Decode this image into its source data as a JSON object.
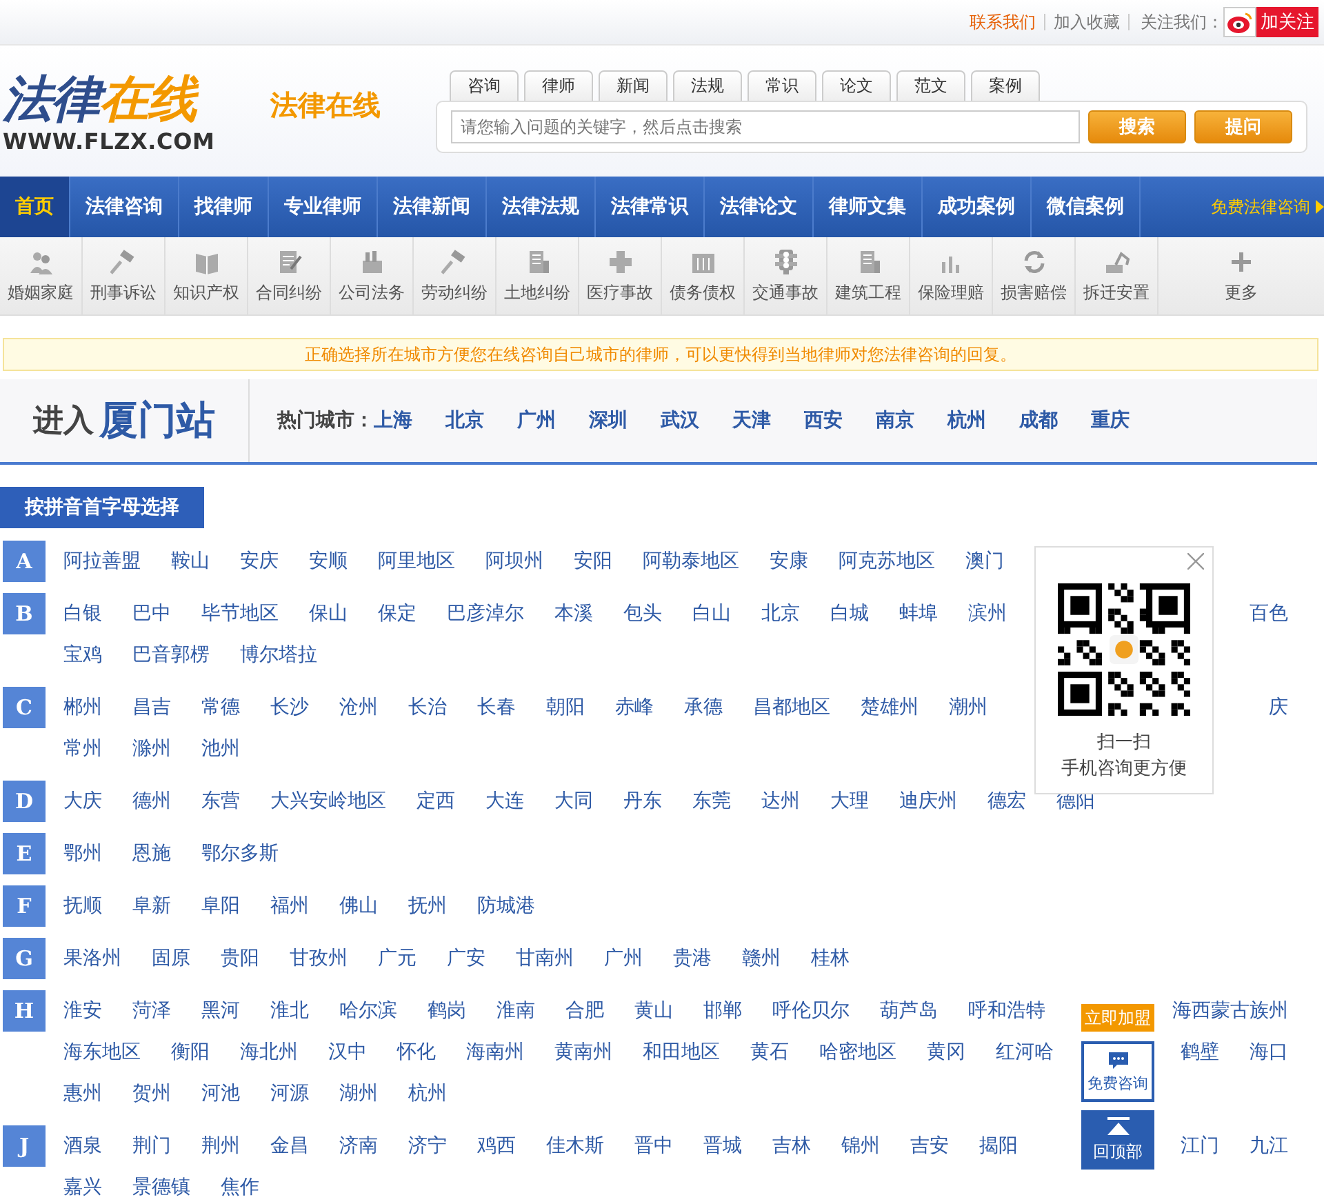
{
  "top_bar": {
    "links": [
      {
        "label": "联系我们",
        "kind": "highlight"
      },
      {
        "label": "加入收藏",
        "kind": "plain"
      }
    ],
    "follow_label": "关注我们：",
    "follow_button": "加关注"
  },
  "logo": {
    "main": "法律",
    "accent": "在线",
    "domain": "WWW.FLZX.COM"
  },
  "site_title": "法律在线",
  "search": {
    "tabs": [
      "咨询",
      "律师",
      "新闻",
      "法规",
      "常识",
      "论文",
      "范文",
      "案例"
    ],
    "placeholder": "请您输入问题的关键字，然后点击搜索",
    "buttons": [
      "搜索",
      "提问"
    ]
  },
  "nav": {
    "items": [
      {
        "label": "首页",
        "selected": true
      },
      {
        "label": "法律咨询",
        "selected": false
      },
      {
        "label": "找律师",
        "selected": false
      },
      {
        "label": "专业律师",
        "selected": false
      },
      {
        "label": "法律新闻",
        "selected": false
      },
      {
        "label": "法律法规",
        "selected": false
      },
      {
        "label": "法律常识",
        "selected": false
      },
      {
        "label": "法律论文",
        "selected": false
      },
      {
        "label": "律师文集",
        "selected": false
      },
      {
        "label": "成功案例",
        "selected": false
      },
      {
        "label": "微信案例",
        "selected": false
      }
    ],
    "promo": "免费法律咨询"
  },
  "categories": [
    "婚姻家庭",
    "刑事诉讼",
    "知识产权",
    "合同纠纷",
    "公司法务",
    "劳动纠纷",
    "土地纠纷",
    "医疗事故",
    "债务债权",
    "交通事故",
    "建筑工程",
    "保险理赔",
    "损害赔偿",
    "拆迁安置",
    "更多"
  ],
  "notice": "正确选择所在城市方便您在线咨询自己城市的律师，可以更快得到当地律师对您法律咨询的回复。",
  "city_box": {
    "enter": "进入",
    "current": "厦门站",
    "hot_label": "热门城市：",
    "hot_cities": [
      "上海",
      "北京",
      "广州",
      "深圳",
      "武汉",
      "天津",
      "西安",
      "南京",
      "杭州",
      "成都",
      "重庆"
    ]
  },
  "pinyin_label": "按拼音首字母选择",
  "letters": [
    {
      "letter": "A",
      "lines": [
        {
          "cities": [
            "阿拉善盟",
            "鞍山",
            "安庆",
            "安顺",
            "阿里地区",
            "阿坝州",
            "安阳",
            "阿勒泰地区",
            "安康",
            "阿克苏地区",
            "澳门"
          ]
        }
      ]
    },
    {
      "letter": "B",
      "lines": [
        {
          "cities": [
            "白银",
            "巴中",
            "毕节地区",
            "保山",
            "保定",
            "巴彦淖尔",
            "本溪",
            "包头",
            "白山",
            "北京",
            "白城",
            "蚌埠",
            "滨州"
          ],
          "beyond": [
            "百色"
          ]
        },
        {
          "cities": [
            "宝鸡",
            "巴音郭楞",
            "博尔塔拉"
          ]
        }
      ]
    },
    {
      "letter": "C",
      "lines": [
        {
          "cities": [
            "郴州",
            "昌吉",
            "常德",
            "长沙",
            "沧州",
            "长治",
            "长春",
            "朝阳",
            "赤峰",
            "承德",
            "昌都地区",
            "楚雄州",
            "潮州"
          ],
          "beyond": [
            "庆"
          ]
        },
        {
          "cities": [
            "常州",
            "滁州",
            "池州"
          ]
        }
      ]
    },
    {
      "letter": "D",
      "lines": [
        {
          "cities": [
            "大庆",
            "德州",
            "东营",
            "大兴安岭地区",
            "定西",
            "大连",
            "大同",
            "丹东",
            "东莞",
            "达州",
            "大理",
            "迪庆州",
            "德宏",
            "德阳"
          ]
        }
      ]
    },
    {
      "letter": "E",
      "lines": [
        {
          "cities": [
            "鄂州",
            "恩施",
            "鄂尔多斯"
          ]
        }
      ]
    },
    {
      "letter": "F",
      "lines": [
        {
          "cities": [
            "抚顺",
            "阜新",
            "阜阳",
            "福州",
            "佛山",
            "抚州",
            "防城港"
          ]
        }
      ]
    },
    {
      "letter": "G",
      "lines": [
        {
          "cities": [
            "果洛州",
            "固原",
            "贵阳",
            "甘孜州",
            "广元",
            "广安",
            "甘南州",
            "广州",
            "贵港",
            "赣州",
            "桂林"
          ]
        }
      ]
    },
    {
      "letter": "H",
      "lines": [
        {
          "cities": [
            "淮安",
            "菏泽",
            "黑河",
            "淮北",
            "哈尔滨",
            "鹤岗",
            "淮南",
            "合肥",
            "黄山",
            "邯郸",
            "呼伦贝尔",
            "葫芦岛",
            "呼和浩特"
          ],
          "beyond": [
            "海西蒙古族州"
          ]
        },
        {
          "cities": [
            "海东地区",
            "衡阳",
            "海北州",
            "汉中",
            "怀化",
            "海南州",
            "黄南州",
            "和田地区",
            "黄石",
            "哈密地区",
            "黄冈",
            "红河哈"
          ],
          "beyond": [
            "鹤壁",
            "海口"
          ]
        },
        {
          "cities": [
            "惠州",
            "贺州",
            "河池",
            "河源",
            "湖州",
            "杭州"
          ]
        }
      ]
    },
    {
      "letter": "J",
      "lines": [
        {
          "cities": [
            "酒泉",
            "荆门",
            "荆州",
            "金昌",
            "济南",
            "济宁",
            "鸡西",
            "佳木斯",
            "晋中",
            "晋城",
            "吉林",
            "锦州",
            "吉安",
            "揭阳"
          ],
          "beyond": [
            "江门",
            "九江"
          ]
        },
        {
          "cities": [
            "嘉兴",
            "景德镇",
            "焦作"
          ]
        }
      ]
    }
  ],
  "qr_popup": {
    "line_1": "扫一扫",
    "line_2": "手机咨询更方便"
  },
  "side_widget": {
    "join": "立即加盟",
    "consult": "免费咨询",
    "top": "回顶部"
  }
}
